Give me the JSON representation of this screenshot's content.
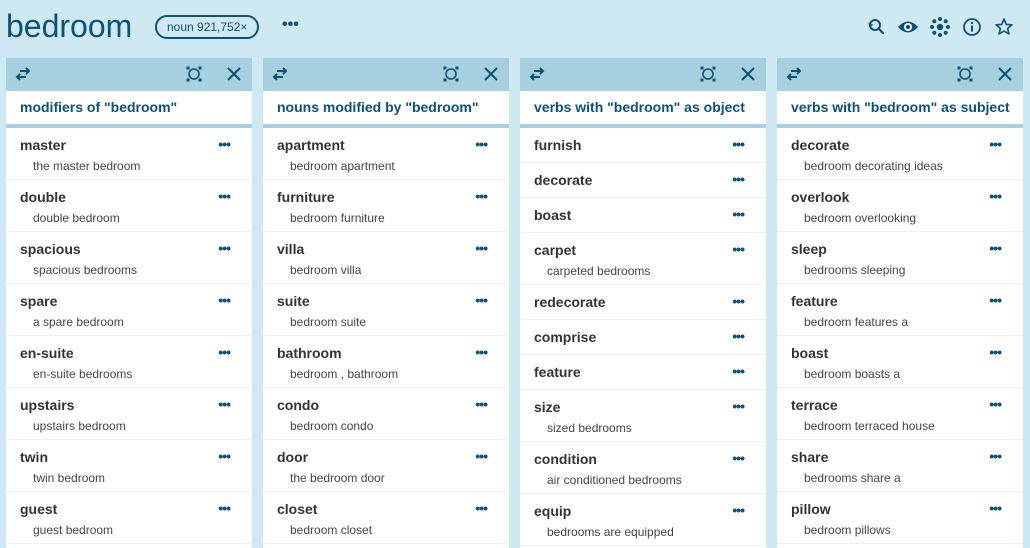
{
  "header": {
    "headword": "bedroom",
    "badge": "noun 921,752×",
    "more": "•••",
    "icons": [
      "search-history-icon",
      "eye-icon",
      "cluster-icon",
      "info-icon",
      "star-icon"
    ]
  },
  "panel_header_icons": [
    "swap-icon",
    "focus-icon",
    "close-icon"
  ],
  "row_menu": "•••",
  "panels": [
    {
      "title": "modifiers of \"bedroom\"",
      "rows": [
        {
          "word": "master",
          "example": "the master bedroom"
        },
        {
          "word": "double",
          "example": "double bedroom"
        },
        {
          "word": "spacious",
          "example": "spacious bedrooms"
        },
        {
          "word": "spare",
          "example": "a spare bedroom"
        },
        {
          "word": "en-suite",
          "example": "en-suite bedrooms"
        },
        {
          "word": "upstairs",
          "example": "upstairs bedroom"
        },
        {
          "word": "twin",
          "example": "twin bedroom"
        },
        {
          "word": "guest",
          "example": "guest bedroom"
        }
      ]
    },
    {
      "title": "nouns modified by \"bedroom\"",
      "rows": [
        {
          "word": "apartment",
          "example": "bedroom apartment"
        },
        {
          "word": "furniture",
          "example": "bedroom furniture"
        },
        {
          "word": "villa",
          "example": "bedroom villa"
        },
        {
          "word": "suite",
          "example": "bedroom suite"
        },
        {
          "word": "bathroom",
          "example": "bedroom , bathroom"
        },
        {
          "word": "condo",
          "example": "bedroom condo"
        },
        {
          "word": "door",
          "example": "the bedroom door"
        },
        {
          "word": "closet",
          "example": "bedroom closet"
        }
      ]
    },
    {
      "title": "verbs with \"bedroom\" as object",
      "rows": [
        {
          "word": "furnish",
          "example": ""
        },
        {
          "word": "decorate",
          "example": ""
        },
        {
          "word": "boast",
          "example": ""
        },
        {
          "word": "carpet",
          "example": "carpeted bedrooms"
        },
        {
          "word": "redecorate",
          "example": ""
        },
        {
          "word": "comprise",
          "example": ""
        },
        {
          "word": "feature",
          "example": ""
        },
        {
          "word": "size",
          "example": "sized bedrooms"
        },
        {
          "word": "condition",
          "example": "air conditioned bedrooms"
        },
        {
          "word": "equip",
          "example": "bedrooms are equipped"
        }
      ]
    },
    {
      "title": "verbs with \"bedroom\" as subject",
      "rows": [
        {
          "word": "decorate",
          "example": "bedroom decorating ideas"
        },
        {
          "word": "overlook",
          "example": "bedroom overlooking"
        },
        {
          "word": "sleep",
          "example": "bedrooms sleeping"
        },
        {
          "word": "feature",
          "example": "bedroom features a"
        },
        {
          "word": "boast",
          "example": "bedroom boasts a"
        },
        {
          "word": "terrace",
          "example": "bedroom terraced house"
        },
        {
          "word": "share",
          "example": "bedrooms share a"
        },
        {
          "word": "pillow",
          "example": "bedroom pillows"
        }
      ]
    }
  ],
  "colors": {
    "background": "#cfe9f3",
    "accent": "#0d5273",
    "panel_header": "#a6cfe0"
  }
}
